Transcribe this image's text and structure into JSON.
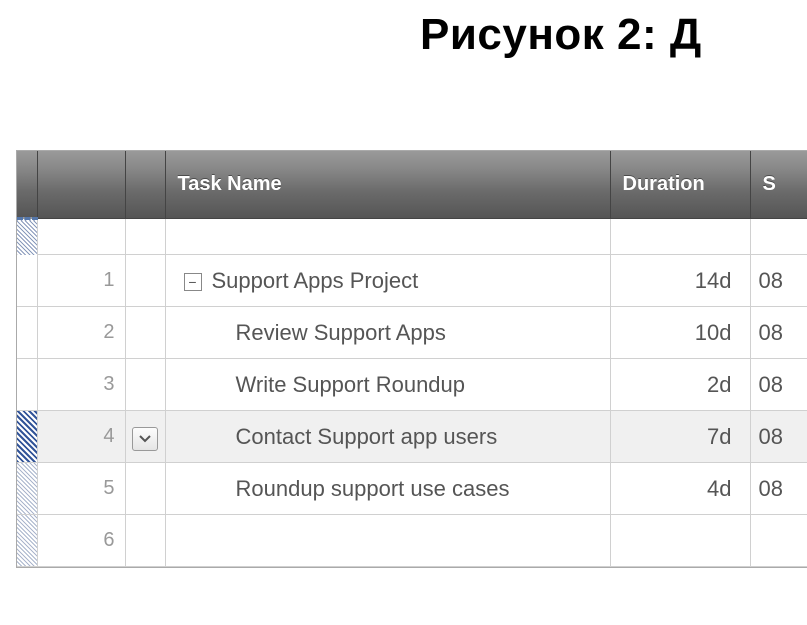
{
  "heading": "Рисунок 2: Д",
  "columns": {
    "name": "Task Name",
    "duration": "Duration",
    "start": "S"
  },
  "rows": [
    {
      "num": "1",
      "name": "Support Apps Project",
      "duration": "14d",
      "start": "08",
      "indent": 0,
      "collapse": "minus"
    },
    {
      "num": "2",
      "name": "Review Support Apps",
      "duration": "10d",
      "start": "08",
      "indent": 1
    },
    {
      "num": "3",
      "name": "Write Support Roundup",
      "duration": "2d",
      "start": "08",
      "indent": 1
    },
    {
      "num": "4",
      "name": "Contact Support app users",
      "duration": "7d",
      "start": "08",
      "indent": 1,
      "selected": true,
      "dropdown": true
    },
    {
      "num": "5",
      "name": "Roundup support use cases",
      "duration": "4d",
      "start": "08",
      "indent": 1
    },
    {
      "num": "6",
      "name": "",
      "duration": "",
      "start": "",
      "indent": 1,
      "empty": true
    }
  ],
  "icons": {
    "collapse_minus": "−",
    "chevron_down": "chevron"
  }
}
